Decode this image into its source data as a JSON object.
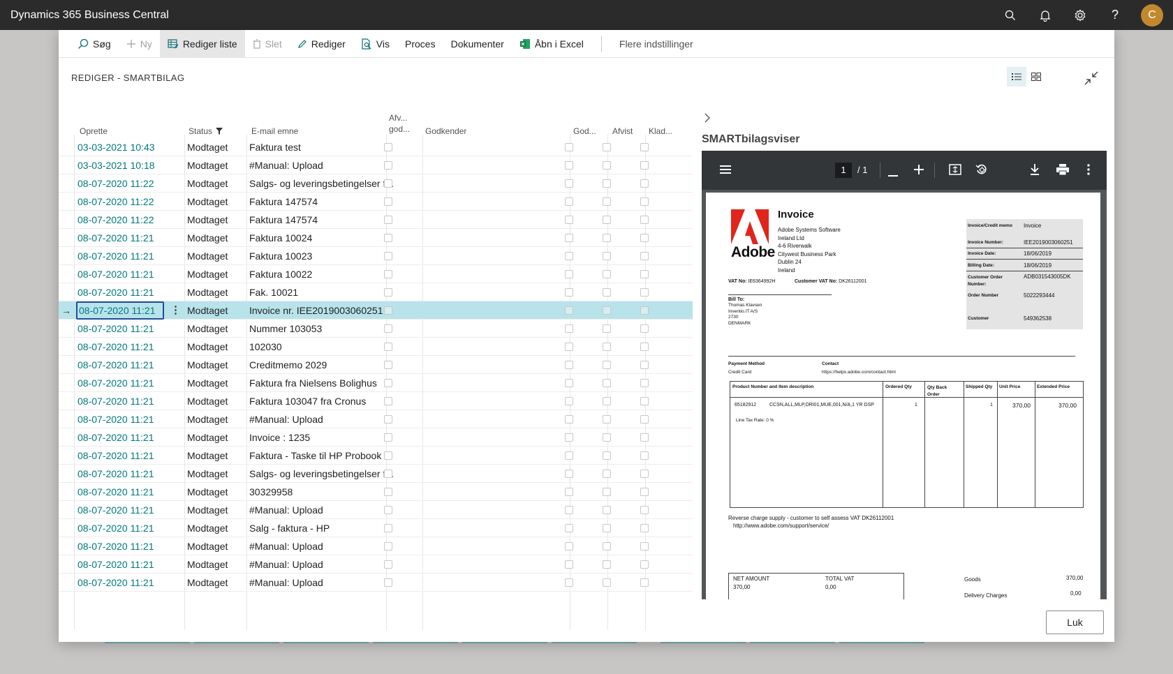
{
  "app": {
    "title": "Dynamics 365 Business Central",
    "avatar_initial": "C"
  },
  "actions": {
    "search": "Søg",
    "new": "Ny",
    "edit_list": "Rediger liste",
    "delete": "Slet",
    "edit": "Rediger",
    "view": "Vis",
    "process": "Proces",
    "documents": "Dokumenter",
    "open_excel": "Åbn i Excel",
    "more_options": "Flere indstillinger"
  },
  "page": {
    "caption": "REDIGER - SMARTBILAG"
  },
  "grid": {
    "headers": {
      "created": "Oprette",
      "status": "Status",
      "email_subject": "E-mail emne",
      "afv_line1": "Afv...",
      "afv_line2": "god...",
      "approver": "Godkender",
      "god": "God...",
      "rejected": "Afvist",
      "draft": "Klad..."
    },
    "rows": [
      {
        "date": "03-03-2021 10:43",
        "status": "Modtaget",
        "subject": "Faktura test"
      },
      {
        "date": "03-03-2021 10:18",
        "status": "Modtaget",
        "subject": "#Manual: Upload"
      },
      {
        "date": "08-07-2020 11:22",
        "status": "Modtaget",
        "subject": "Salgs- og leveringsbetingelser f..."
      },
      {
        "date": "08-07-2020 11:22",
        "status": "Modtaget",
        "subject": "Faktura 147574"
      },
      {
        "date": "08-07-2020 11:22",
        "status": "Modtaget",
        "subject": "Faktura 147574"
      },
      {
        "date": "08-07-2020 11:21",
        "status": "Modtaget",
        "subject": "Faktura 10024"
      },
      {
        "date": "08-07-2020 11:21",
        "status": "Modtaget",
        "subject": "Faktura 10023"
      },
      {
        "date": "08-07-2020 11:21",
        "status": "Modtaget",
        "subject": "Faktura 10022"
      },
      {
        "date": "08-07-2020 11:21",
        "status": "Modtaget",
        "subject": "Fak. 10021"
      },
      {
        "date": "08-07-2020 11:21",
        "status": "Modtaget",
        "subject": "Invoice nr. IEE2019003060251",
        "selected": true
      },
      {
        "date": "08-07-2020 11:21",
        "status": "Modtaget",
        "subject": "Nummer 103053"
      },
      {
        "date": "08-07-2020 11:21",
        "status": "Modtaget",
        "subject": "102030"
      },
      {
        "date": "08-07-2020 11:21",
        "status": "Modtaget",
        "subject": "Creditmemo 2029"
      },
      {
        "date": "08-07-2020 11:21",
        "status": "Modtaget",
        "subject": "Faktura fra Nielsens Bolighus"
      },
      {
        "date": "08-07-2020 11:21",
        "status": "Modtaget",
        "subject": "Faktura 103047 fra Cronus"
      },
      {
        "date": "08-07-2020 11:21",
        "status": "Modtaget",
        "subject": "#Manual: Upload"
      },
      {
        "date": "08-07-2020 11:21",
        "status": "Modtaget",
        "subject": "Invoice : 1235"
      },
      {
        "date": "08-07-2020 11:21",
        "status": "Modtaget",
        "subject": "Faktura - Taske til HP Probook ..."
      },
      {
        "date": "08-07-2020 11:21",
        "status": "Modtaget",
        "subject": "Salgs- og leveringsbetingelser f..."
      },
      {
        "date": "08-07-2020 11:21",
        "status": "Modtaget",
        "subject": "30329958"
      },
      {
        "date": "08-07-2020 11:21",
        "status": "Modtaget",
        "subject": "#Manual: Upload"
      },
      {
        "date": "08-07-2020 11:21",
        "status": "Modtaget",
        "subject": "Salg - faktura - HP"
      },
      {
        "date": "08-07-2020 11:21",
        "status": "Modtaget",
        "subject": "#Manual: Upload"
      },
      {
        "date": "08-07-2020 11:21",
        "status": "Modtaget",
        "subject": "#Manual: Upload"
      },
      {
        "date": "08-07-2020 11:21",
        "status": "Modtaget",
        "subject": "#Manual: Upload"
      }
    ]
  },
  "factbox": {
    "title": "SMARTbilagsviser"
  },
  "pdf": {
    "page_current": "1",
    "page_total": "/  1",
    "invoice": {
      "logo_text": "Adobe",
      "heading": "Invoice",
      "seller": [
        "Adobe Systems Software",
        "Ireland Ltd",
        "4-6 Riverwalk",
        "Citywest Business Park",
        "Dublin 24",
        "Ireland"
      ],
      "vat_no_label": "VAT No:",
      "vat_no": "IE6364992H",
      "customer_vat_label": "Customer VAT No:",
      "customer_vat": "DK26112001",
      "info": [
        {
          "label": "Invoice/Credit memo",
          "value": "Invoice"
        },
        {
          "label": "Invoice Number:",
          "value": "IEE2019003060251"
        },
        {
          "label": "Invoice Date:",
          "value": "18/06/2019"
        },
        {
          "label": "Billing Date:",
          "value": "18/06/2019"
        },
        {
          "label": "Customer Order Number:",
          "value": "ADB031543005DK"
        },
        {
          "label": "Order Number",
          "value": "5022293444"
        },
        {
          "label": "Customer",
          "value": "549362538"
        }
      ],
      "bill_to_label": "Bill To:",
      "bill_to": [
        "Thomas Klavsen",
        "Inventio.IT A/S",
        "2730",
        "DENMARK"
      ],
      "payment_method_label": "Payment Method",
      "payment_method": "Credit Card",
      "contact_label": "Contact",
      "contact": "https://helpx.adobe.com/contact.html",
      "table_headers": [
        "Product Number and Item description",
        "Ordered Qty",
        "Qty Back Order",
        "Shipped Qty",
        "Unit Price",
        "Extended Price"
      ],
      "item": {
        "number": "65182912",
        "desc": "CCSN,ALL,MLP,DRI01,MUE,001,N/A,1 YR DSP",
        "ordered": "1",
        "shipped": "1",
        "unit_price": "370,00",
        "extended": "370,00",
        "tax_line": "Line Tax Rate: 0   %"
      },
      "reverse_charge": "Reverse charge supply - customer to self assess VAT  DK26112001",
      "support_url": "http://www.adobe.com/support/service/",
      "net_amount_label": "NET AMOUNT",
      "net_amount": "370,00",
      "total_vat_label": "TOTAL VAT",
      "total_vat": "0,00",
      "goods_label": "Goods",
      "goods": "370,00",
      "delivery_label": "Delivery Charges",
      "delivery": "0,00"
    }
  },
  "footer": {
    "close": "Luk"
  }
}
